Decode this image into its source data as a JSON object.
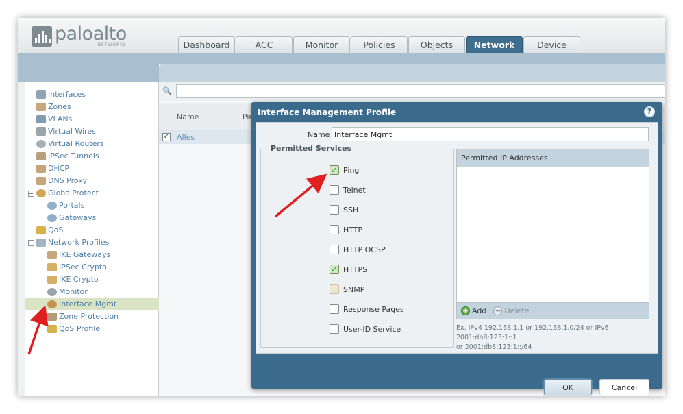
{
  "logo": {
    "word": "paloalto",
    "sub": "NETWORKS"
  },
  "tabs": [
    {
      "label": "Dashboard"
    },
    {
      "label": "ACC"
    },
    {
      "label": "Monitor"
    },
    {
      "label": "Policies"
    },
    {
      "label": "Objects"
    },
    {
      "label": "Network",
      "active": true
    },
    {
      "label": "Device"
    }
  ],
  "sidebar": {
    "items": [
      {
        "label": "Interfaces",
        "icon": "interfaces-icon"
      },
      {
        "label": "Zones",
        "icon": "zones-icon"
      },
      {
        "label": "VLANs",
        "icon": "vlans-icon"
      },
      {
        "label": "Virtual Wires",
        "icon": "virtual-wires-icon"
      },
      {
        "label": "Virtual Routers",
        "icon": "virtual-routers-icon"
      },
      {
        "label": "IPSec Tunnels",
        "icon": "ipsec-tunnels-icon"
      },
      {
        "label": "DHCP",
        "icon": "dhcp-icon"
      },
      {
        "label": "DNS Proxy",
        "icon": "dns-proxy-icon"
      },
      {
        "label": "GlobalProtect",
        "icon": "globalprotect-icon"
      },
      {
        "label": "Portals",
        "icon": "portals-icon"
      },
      {
        "label": "Gateways",
        "icon": "gateways-icon"
      },
      {
        "label": "QoS",
        "icon": "qos-icon"
      },
      {
        "label": "Network Profiles",
        "icon": "network-profiles-icon"
      },
      {
        "label": "IKE Gateways",
        "icon": "ike-gateways-icon"
      },
      {
        "label": "IPSec Crypto",
        "icon": "lock-icon"
      },
      {
        "label": "IKE Crypto",
        "icon": "lock-icon"
      },
      {
        "label": "Monitor",
        "icon": "monitor-icon"
      },
      {
        "label": "Interface Mgmt",
        "icon": "interface-mgmt-icon",
        "selected": true
      },
      {
        "label": "Zone Protection",
        "icon": "zone-protection-icon"
      },
      {
        "label": "QoS Profile",
        "icon": "qos-profile-icon"
      }
    ]
  },
  "grid": {
    "columns": {
      "name": "Name",
      "ping": "Pin"
    },
    "rows": [
      {
        "name": "Alles"
      }
    ]
  },
  "dialog": {
    "title": "Interface Management Profile",
    "name_label": "Name",
    "name_value": "Interface Mgmt",
    "permitted_services_title": "Permitted Services",
    "services": [
      {
        "label": "Ping",
        "checked": true
      },
      {
        "label": "Telnet",
        "checked": false
      },
      {
        "label": "SSH",
        "checked": false
      },
      {
        "label": "HTTP",
        "checked": false
      },
      {
        "label": "HTTP OCSP",
        "checked": false
      },
      {
        "label": "HTTPS",
        "checked": true
      },
      {
        "label": "SNMP",
        "checked": false,
        "disabled": true
      },
      {
        "label": "Response Pages",
        "checked": false
      },
      {
        "label": "User-ID Service",
        "checked": false
      }
    ],
    "permitted_ip_header": "Permitted IP Addresses",
    "add_label": "Add",
    "delete_label": "Delete",
    "hint_line1": "Ex. IPv4 192.168.1.1 or 192.168.1.0/24 or IPv6 2001:db8:123:1::1",
    "hint_line2": "or 2001:db8:123:1::/64",
    "ok_label": "OK",
    "cancel_label": "Cancel"
  },
  "colors": {
    "accent": "#3a6a8c",
    "link": "#4f7fa6",
    "annotation_arrow": "#e02020",
    "check_green": "#2e8b2e"
  }
}
